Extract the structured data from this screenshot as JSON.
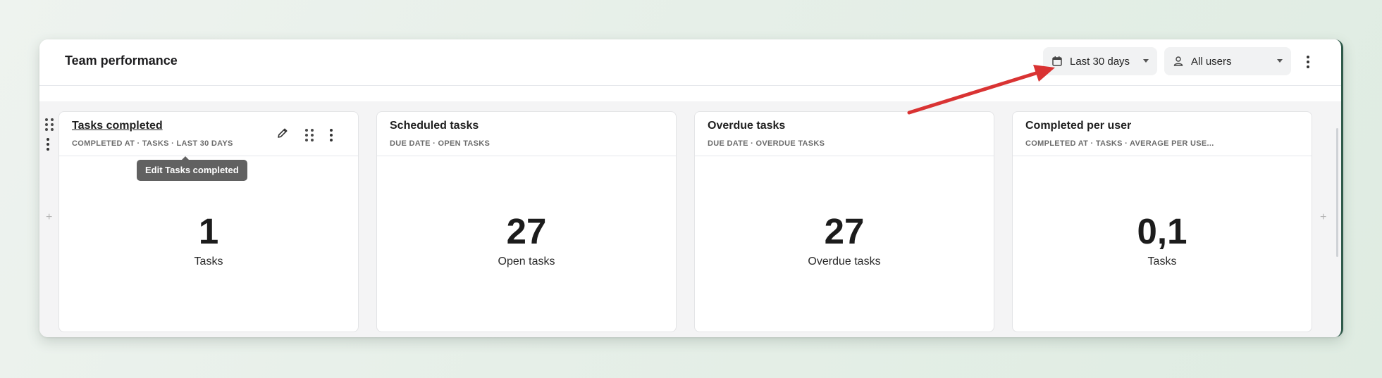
{
  "header": {
    "title": "Team performance",
    "date_filter": "Last 30 days",
    "user_filter": "All users"
  },
  "cards": [
    {
      "title": "Tasks completed",
      "subtitle": "COMPLETED AT · TASKS · LAST 30 DAYS",
      "value": "1",
      "label": "Tasks"
    },
    {
      "title": "Scheduled tasks",
      "subtitle": "DUE DATE · OPEN TASKS",
      "value": "27",
      "label": "Open tasks"
    },
    {
      "title": "Overdue tasks",
      "subtitle": "DUE DATE · OVERDUE TASKS",
      "value": "27",
      "label": "Overdue tasks"
    },
    {
      "title": "Completed per user",
      "subtitle": "COMPLETED AT · TASKS · AVERAGE PER USE...",
      "value": "0,1",
      "label": "Tasks"
    }
  ],
  "tooltip": "Edit Tasks completed",
  "icons": {
    "calendar": "calendar-icon",
    "user": "user-icon",
    "pencil": "pencil-icon",
    "drag": "drag-handle-icon",
    "more": "more-vertical-icon",
    "plus": "plus-icon"
  },
  "colors": {
    "annotation_arrow": "#d93333",
    "tooltip_bg": "#616161",
    "accent_border": "#2f5a4a"
  }
}
